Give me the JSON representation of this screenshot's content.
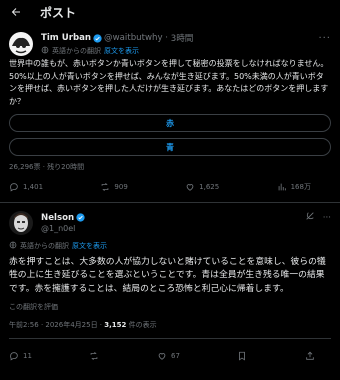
{
  "header": {
    "title": "ポスト"
  },
  "post": {
    "author_name": "Tim Urban",
    "author_handle": "@waitbutwhy",
    "time": "3時間",
    "translate_label": "英語からの翻訳",
    "show_original": "原文を表示",
    "text": "世界中の誰もが、赤いボタンか青いボタンを押して秘密の投票をしなければなりません。50%以上の人が青いボタンを押せば、みんなが生き延びます。50%未満の人が青いボタンを押せば、赤いボタンを押した人だけが生き延びます。あなたはどのボタンを押しますか？",
    "poll": {
      "options": [
        "赤",
        "青"
      ],
      "meta": "26,296票 · 残り20時間"
    },
    "actions": {
      "replies": "1,401",
      "reposts": "909",
      "likes": "1,625",
      "views": "168万"
    }
  },
  "reply": {
    "author_name": "Nelson",
    "author_handle": "@1_n0el",
    "translate_label": "英語からの翻訳",
    "show_original": "原文を表示",
    "text": "赤を押すことは、大多数の人が協力しないと賭けていることを意味し、彼らの犠牲の上に生き延びることを選ぶということです。青は全員が生き残る唯一の結果です。赤を擁護することは、結局のところ恐怖と利己心に帰着します。",
    "translation_note": "この翻訳を評価",
    "meta_time": "午前2:56 · 2026年4月25日 · ",
    "meta_views": "3,152",
    "meta_views_suffix": " 件の表示",
    "actions": {
      "replies": "11",
      "reposts": "",
      "likes": "67",
      "bookmarks": ""
    }
  },
  "colors": {
    "accent": "#1d9bf0",
    "verified": "#1d9bf0",
    "text": "#e7e9ea",
    "muted": "#71767b"
  }
}
